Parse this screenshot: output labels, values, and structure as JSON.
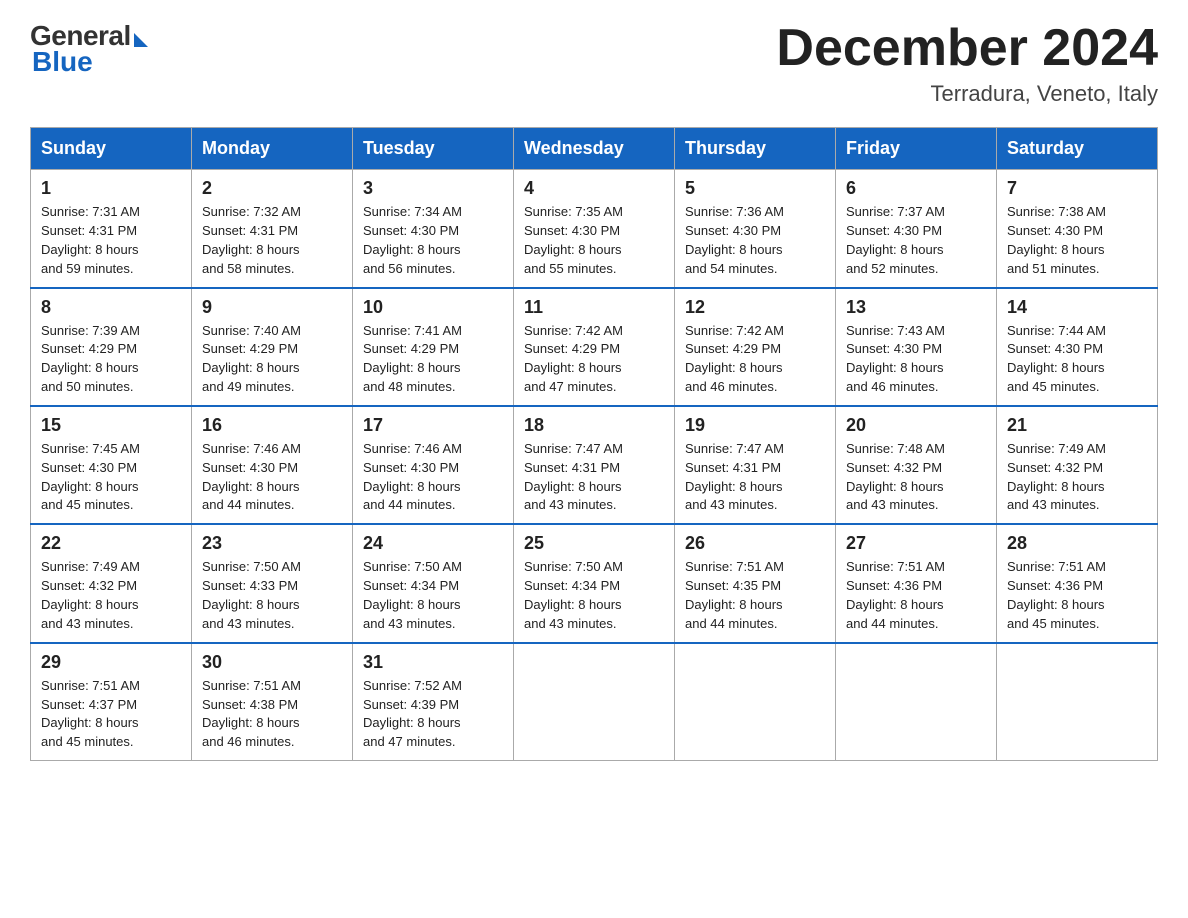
{
  "logo": {
    "general": "General",
    "blue": "Blue"
  },
  "title": {
    "month_year": "December 2024",
    "location": "Terradura, Veneto, Italy"
  },
  "headers": [
    "Sunday",
    "Monday",
    "Tuesday",
    "Wednesday",
    "Thursday",
    "Friday",
    "Saturday"
  ],
  "weeks": [
    [
      {
        "day": "1",
        "sunrise": "7:31 AM",
        "sunset": "4:31 PM",
        "daylight": "8 hours and 59 minutes."
      },
      {
        "day": "2",
        "sunrise": "7:32 AM",
        "sunset": "4:31 PM",
        "daylight": "8 hours and 58 minutes."
      },
      {
        "day": "3",
        "sunrise": "7:34 AM",
        "sunset": "4:30 PM",
        "daylight": "8 hours and 56 minutes."
      },
      {
        "day": "4",
        "sunrise": "7:35 AM",
        "sunset": "4:30 PM",
        "daylight": "8 hours and 55 minutes."
      },
      {
        "day": "5",
        "sunrise": "7:36 AM",
        "sunset": "4:30 PM",
        "daylight": "8 hours and 54 minutes."
      },
      {
        "day": "6",
        "sunrise": "7:37 AM",
        "sunset": "4:30 PM",
        "daylight": "8 hours and 52 minutes."
      },
      {
        "day": "7",
        "sunrise": "7:38 AM",
        "sunset": "4:30 PM",
        "daylight": "8 hours and 51 minutes."
      }
    ],
    [
      {
        "day": "8",
        "sunrise": "7:39 AM",
        "sunset": "4:29 PM",
        "daylight": "8 hours and 50 minutes."
      },
      {
        "day": "9",
        "sunrise": "7:40 AM",
        "sunset": "4:29 PM",
        "daylight": "8 hours and 49 minutes."
      },
      {
        "day": "10",
        "sunrise": "7:41 AM",
        "sunset": "4:29 PM",
        "daylight": "8 hours and 48 minutes."
      },
      {
        "day": "11",
        "sunrise": "7:42 AM",
        "sunset": "4:29 PM",
        "daylight": "8 hours and 47 minutes."
      },
      {
        "day": "12",
        "sunrise": "7:42 AM",
        "sunset": "4:29 PM",
        "daylight": "8 hours and 46 minutes."
      },
      {
        "day": "13",
        "sunrise": "7:43 AM",
        "sunset": "4:30 PM",
        "daylight": "8 hours and 46 minutes."
      },
      {
        "day": "14",
        "sunrise": "7:44 AM",
        "sunset": "4:30 PM",
        "daylight": "8 hours and 45 minutes."
      }
    ],
    [
      {
        "day": "15",
        "sunrise": "7:45 AM",
        "sunset": "4:30 PM",
        "daylight": "8 hours and 45 minutes."
      },
      {
        "day": "16",
        "sunrise": "7:46 AM",
        "sunset": "4:30 PM",
        "daylight": "8 hours and 44 minutes."
      },
      {
        "day": "17",
        "sunrise": "7:46 AM",
        "sunset": "4:30 PM",
        "daylight": "8 hours and 44 minutes."
      },
      {
        "day": "18",
        "sunrise": "7:47 AM",
        "sunset": "4:31 PM",
        "daylight": "8 hours and 43 minutes."
      },
      {
        "day": "19",
        "sunrise": "7:47 AM",
        "sunset": "4:31 PM",
        "daylight": "8 hours and 43 minutes."
      },
      {
        "day": "20",
        "sunrise": "7:48 AM",
        "sunset": "4:32 PM",
        "daylight": "8 hours and 43 minutes."
      },
      {
        "day": "21",
        "sunrise": "7:49 AM",
        "sunset": "4:32 PM",
        "daylight": "8 hours and 43 minutes."
      }
    ],
    [
      {
        "day": "22",
        "sunrise": "7:49 AM",
        "sunset": "4:32 PM",
        "daylight": "8 hours and 43 minutes."
      },
      {
        "day": "23",
        "sunrise": "7:50 AM",
        "sunset": "4:33 PM",
        "daylight": "8 hours and 43 minutes."
      },
      {
        "day": "24",
        "sunrise": "7:50 AM",
        "sunset": "4:34 PM",
        "daylight": "8 hours and 43 minutes."
      },
      {
        "day": "25",
        "sunrise": "7:50 AM",
        "sunset": "4:34 PM",
        "daylight": "8 hours and 43 minutes."
      },
      {
        "day": "26",
        "sunrise": "7:51 AM",
        "sunset": "4:35 PM",
        "daylight": "8 hours and 44 minutes."
      },
      {
        "day": "27",
        "sunrise": "7:51 AM",
        "sunset": "4:36 PM",
        "daylight": "8 hours and 44 minutes."
      },
      {
        "day": "28",
        "sunrise": "7:51 AM",
        "sunset": "4:36 PM",
        "daylight": "8 hours and 45 minutes."
      }
    ],
    [
      {
        "day": "29",
        "sunrise": "7:51 AM",
        "sunset": "4:37 PM",
        "daylight": "8 hours and 45 minutes."
      },
      {
        "day": "30",
        "sunrise": "7:51 AM",
        "sunset": "4:38 PM",
        "daylight": "8 hours and 46 minutes."
      },
      {
        "day": "31",
        "sunrise": "7:52 AM",
        "sunset": "4:39 PM",
        "daylight": "8 hours and 47 minutes."
      },
      null,
      null,
      null,
      null
    ]
  ],
  "labels": {
    "sunrise": "Sunrise: ",
    "sunset": "Sunset: ",
    "daylight": "Daylight: "
  }
}
